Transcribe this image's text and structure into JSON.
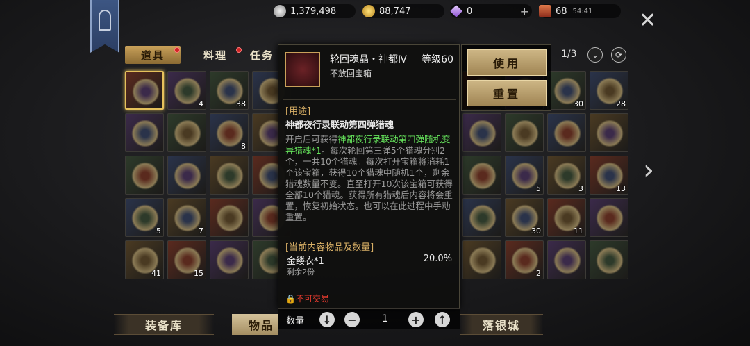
{
  "currencies": [
    {
      "name": "silver",
      "value": "1,379,498",
      "color": "#c0c0c0"
    },
    {
      "name": "gold",
      "value": "88,747",
      "color": "#e2b23a"
    },
    {
      "name": "diamond",
      "value": "0",
      "color": "#c9a2ff"
    },
    {
      "name": "energy",
      "value": "68",
      "timer": "54:41",
      "color": "#c05a3a"
    }
  ],
  "tabs": [
    "道具",
    "料理",
    "任务"
  ],
  "pager": "1/3",
  "tooltip": {
    "name": "轮回魂晶・神都Ⅳ",
    "level": "等级60",
    "subtitle": "不放回宝箱",
    "usage_header": "[用途]",
    "usage_title": "神都夜行录联动第四弹猎魂",
    "desc_pre": "开启后可获得",
    "desc_highlight": "神都夜行录联动第四弹随机变异猎魂*1",
    "desc_post": "。每次轮回第三弹5个猎魂分别2个，一共10个猎魂。每次打开宝箱将消耗1个该宝箱，获得10个猎魂中随机1个，剩余猎魂数量不变。直至打开10次该宝箱可获得全部10个猎魂。获得所有猎魂后内容将会重置，恢复初始状态。也可以在此过程中手动重置。",
    "contents_header": "[当前内容物品及数量]",
    "item_name": "金缕衣*1",
    "item_remaining": "剩余2份",
    "item_rate": "20.0%",
    "no_trade": "不可交易"
  },
  "quantity": {
    "label": "数量",
    "value": "1"
  },
  "actions": {
    "use": "使用",
    "reset": "重置"
  },
  "bottom_nav": [
    "装备库",
    "物品",
    "落银城"
  ],
  "grid_left": [
    [
      "",
      "4",
      "38",
      ""
    ],
    [
      "",
      "",
      "8",
      ""
    ],
    [
      "",
      "",
      "",
      ""
    ],
    [
      "5",
      "7",
      "",
      ""
    ],
    [
      "41",
      "15",
      "",
      ""
    ]
  ],
  "grid_right": [
    [
      "",
      "",
      "30",
      "28"
    ],
    [
      "",
      "",
      "",
      ""
    ],
    [
      "",
      "5",
      "3",
      "13"
    ],
    [
      "",
      "30",
      "11",
      ""
    ],
    [
      "",
      "2",
      "",
      ""
    ]
  ]
}
